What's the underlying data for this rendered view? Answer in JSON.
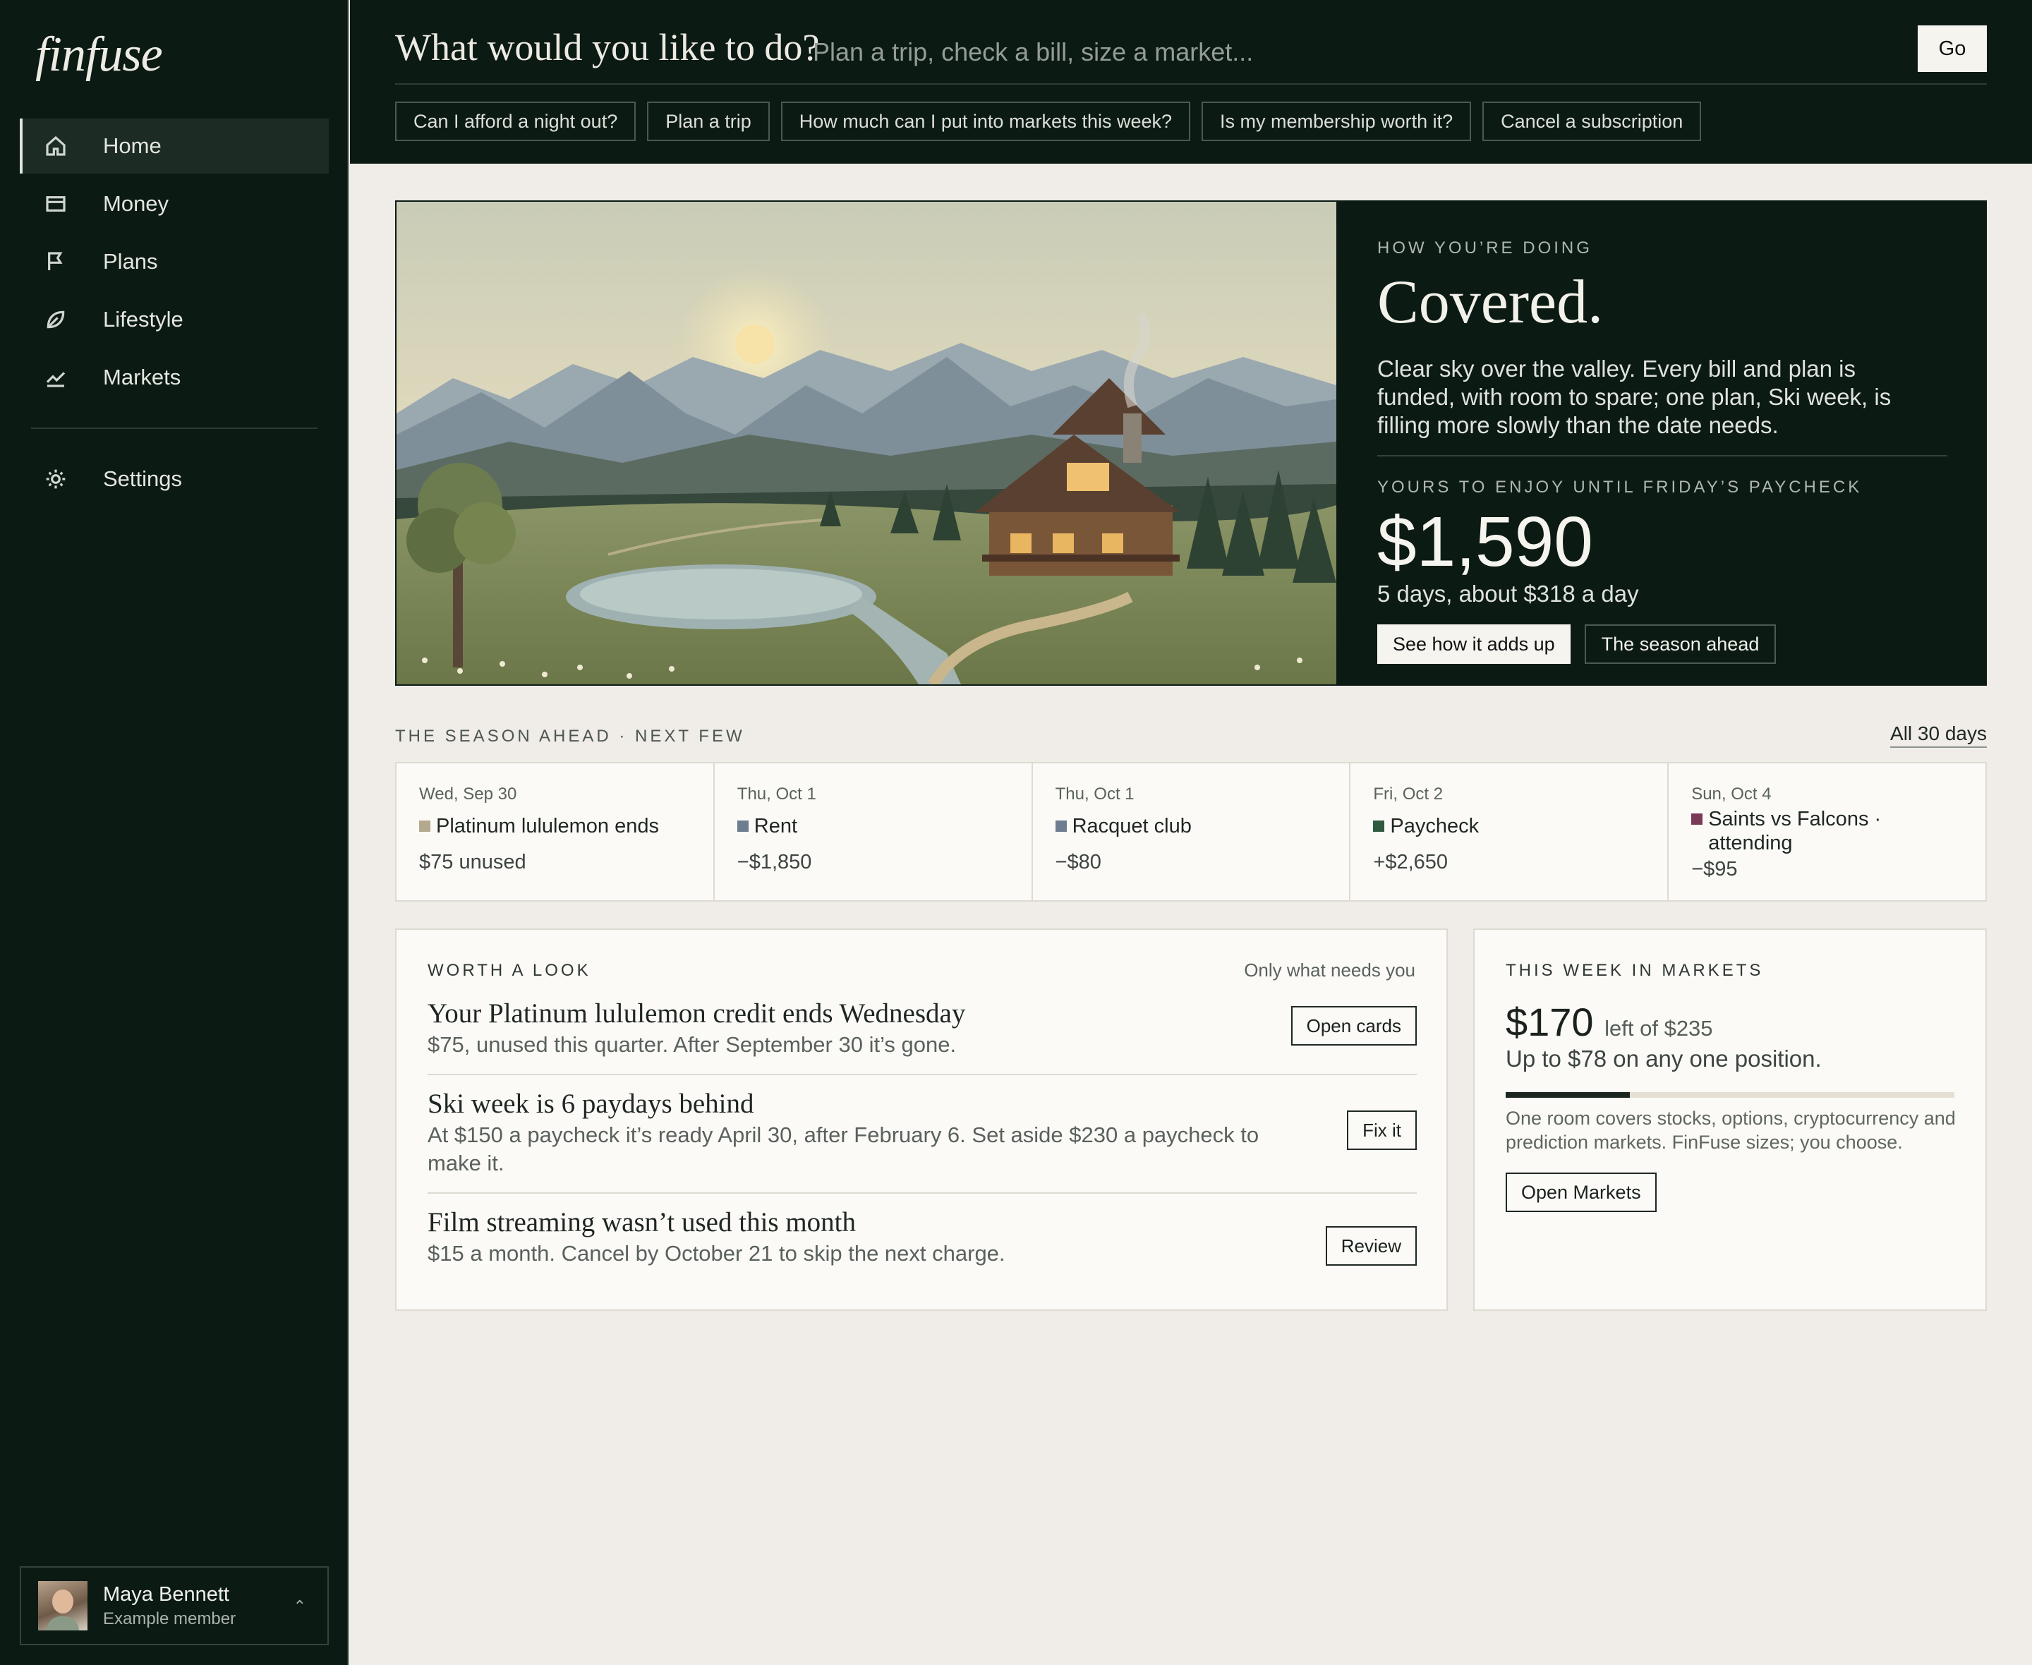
{
  "app": {
    "logo": "finfuse"
  },
  "sidebar": {
    "items": [
      {
        "label": "Home",
        "icon": "home-icon",
        "active": true
      },
      {
        "label": "Money",
        "icon": "wallet-icon"
      },
      {
        "label": "Plans",
        "icon": "flag-icon"
      },
      {
        "label": "Lifestyle",
        "icon": "leaf-icon"
      },
      {
        "label": "Markets",
        "icon": "chart-line-icon"
      }
    ],
    "settings": {
      "label": "Settings",
      "icon": "gear-icon"
    }
  },
  "user": {
    "name": "Maya Bennett",
    "subtitle": "Example member"
  },
  "topbar": {
    "question": "What would you like to do?",
    "placeholder": "Plan a trip, check a bill, size a market...",
    "go_label": "Go",
    "chips": [
      "Can I afford a night out?",
      "Plan a trip",
      "How much can I put into markets this week?",
      "Is my membership worth it?",
      "Cancel a subscription"
    ]
  },
  "hero": {
    "eyebrow": "HOW YOU’RE DOING",
    "title": "Covered.",
    "description": "Clear sky over the valley. Every bill and plan is funded, with room to spare; one plan, Ski week, is filling more slowly than the date needs.",
    "enjoy_label": "YOURS TO ENJOY UNTIL FRIDAY’S PAYCHECK",
    "amount": "$1,590",
    "amount_sub": "5 days, about $318 a day",
    "btn_primary": "See how it adds up",
    "btn_secondary": "The season ahead"
  },
  "season": {
    "heading": "THE SEASON AHEAD · NEXT FEW",
    "all_link": "All 30 days",
    "events": [
      {
        "date": "Wed, Sep 30",
        "title": "Platinum lululemon ends",
        "amount": "$75 unused",
        "color": "#b3a98d"
      },
      {
        "date": "Thu, Oct 1",
        "title": "Rent",
        "amount": "−$1,850",
        "color": "#6e7c90"
      },
      {
        "date": "Thu, Oct 1",
        "title": "Racquet club",
        "amount": "−$80",
        "color": "#6e7c90"
      },
      {
        "date": "Fri, Oct 2",
        "title": "Paycheck",
        "amount": "+$2,650",
        "color": "#2f5a3f"
      },
      {
        "date": "Sun, Oct 4",
        "title": "Saints vs Falcons · attending",
        "amount": "−$95",
        "color": "#7a3a55"
      }
    ]
  },
  "worth": {
    "label": "WORTH A LOOK",
    "filter": "Only what needs you",
    "items": [
      {
        "title": "Your Platinum lululemon credit ends Wednesday",
        "desc": "$75, unused this quarter. After September 30 it’s gone.",
        "action": "Open cards"
      },
      {
        "title": "Ski week is 6 paydays behind",
        "desc": "At $150 a paycheck it’s ready April 30, after February 6. Set aside $230 a paycheck to make it.",
        "action": "Fix it"
      },
      {
        "title": "Film streaming wasn’t used this month",
        "desc": "$15 a month. Cancel by October 21 to skip the next charge.",
        "action": "Review"
      }
    ]
  },
  "markets": {
    "label": "THIS WEEK IN MARKETS",
    "amount": "$170",
    "left_of": "left of $235",
    "sub": "Up to $78 on any one position.",
    "used_fraction": 0.277,
    "desc": "One room covers stocks, options, cryptocurrency and prediction markets. FinFuse sizes; you choose.",
    "btn": "Open Markets"
  }
}
